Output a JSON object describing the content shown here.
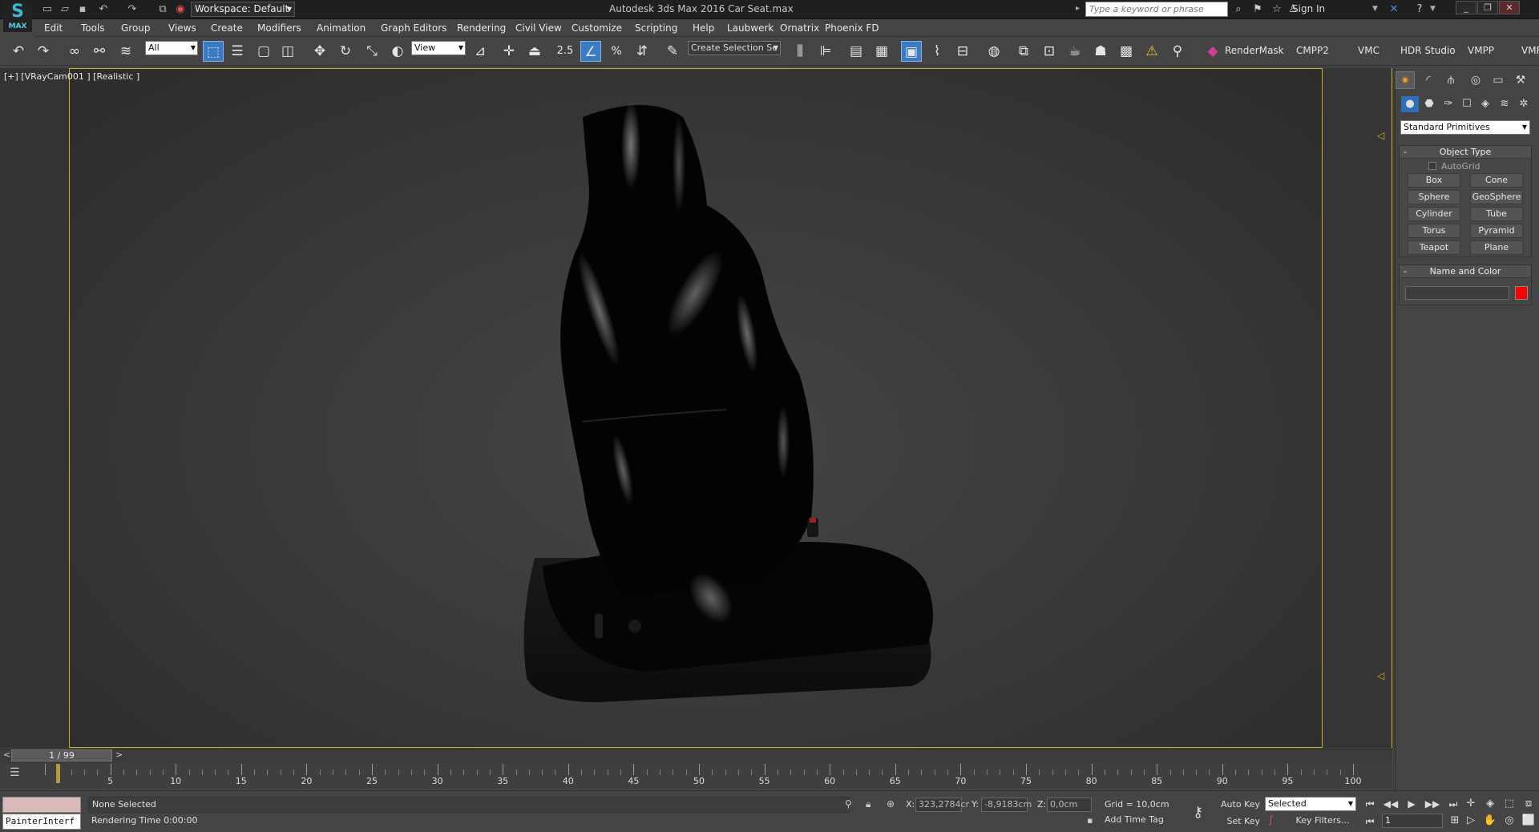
{
  "titlebar": {
    "app_logo_label": "MAX",
    "workspace": "Workspace: Default",
    "title": "Autodesk 3ds Max 2016      Car Seat.max",
    "search_placeholder": "Type a keyword or phrase",
    "signin": "Sign In"
  },
  "menu": [
    "Edit",
    "Tools",
    "Group",
    "Views",
    "Create",
    "Modifiers",
    "Animation",
    "Graph Editors",
    "Rendering",
    "Civil View",
    "Customize",
    "Scripting",
    "Help",
    "Laubwerk",
    "Ornatrix",
    "Phoenix FD"
  ],
  "toolbar": {
    "selection_filter": "All",
    "ref_coord": "View",
    "snap_label": "2.5",
    "named_selection": "Create Selection Se",
    "plugins": [
      "RenderMask",
      "CMPP2",
      "VMC",
      "HDR Studio",
      "VMPP",
      "VMF"
    ]
  },
  "viewport": {
    "label": "[+] [VRayCam001 ] [Realistic ]"
  },
  "command_panel": {
    "category": "Standard Primitives",
    "object_type_title": "Object Type",
    "autogrid": "AutoGrid",
    "objects": [
      "Box",
      "Cone",
      "Sphere",
      "GeoSphere",
      "Cylinder",
      "Tube",
      "Torus",
      "Pyramid",
      "Teapot",
      "Plane"
    ],
    "name_color_title": "Name and Color",
    "object_color": "#ff0000",
    "collapse_symbol": "-"
  },
  "timeline": {
    "frame_display": "1 / 99",
    "current_frame": 1,
    "frame_end": 100,
    "ticks": [
      5,
      10,
      15,
      20,
      25,
      30,
      35,
      40,
      45,
      50,
      55,
      60,
      65,
      70,
      75,
      80,
      85,
      90,
      95,
      100
    ]
  },
  "status": {
    "listener": "PainterInterf",
    "selection": "None Selected",
    "prompt": "Rendering Time  0:00:00",
    "x_label": "X:",
    "x_value": "323,2784cr",
    "y_label": "Y:",
    "y_value": "-8,9183cm",
    "z_label": "Z:",
    "z_value": "0,0cm",
    "grid": "Grid = 10,0cm",
    "add_time_tag": "Add Time Tag",
    "auto_key": "Auto Key",
    "set_key": "Set Key",
    "key_mode": "Selected",
    "key_filters": "Key Filters...",
    "frame": "1"
  }
}
